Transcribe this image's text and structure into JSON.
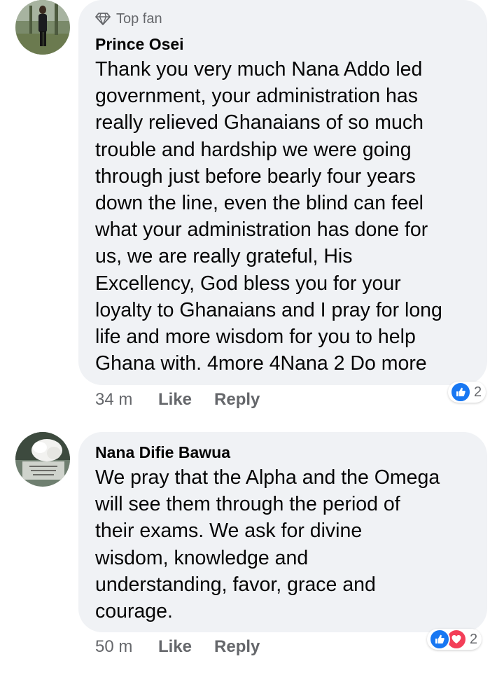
{
  "colors": {
    "bubble": "#f0f2f5",
    "secondary_text": "#65676b",
    "like_blue": "#1877f2",
    "love_red": "#f33e58"
  },
  "comments": [
    {
      "badge_icon": "diamond-icon",
      "badge": "Top fan",
      "author": "Prince Osei",
      "lines": [
        "Thank you very much Nana Addo led",
        "government, your administration has",
        "really relieved Ghanaians of so much",
        "trouble and hardship we were going",
        "through just before bearly four years",
        "down the line, even the blind can feel",
        "what your administration has done for",
        "us, we are really grateful, His",
        "Excellency, God bless you for your",
        "loyalty to Ghanaians and I pray for long",
        "life and more wisdom for you to help",
        "Ghana with. 4more 4Nana 2 Do more"
      ],
      "time": "34 m",
      "like_label": "Like",
      "reply_label": "Reply",
      "reactions": [
        "like-icon"
      ],
      "reaction_count": "2"
    },
    {
      "author": "Nana Difie Bawua",
      "lines": [
        "We pray that the Alpha and the Omega",
        "will see them through the period of",
        "their exams. We ask for divine",
        "wisdom, knowledge and",
        "understanding, favor, grace and",
        "courage."
      ],
      "time": "50 m",
      "like_label": "Like",
      "reply_label": "Reply",
      "reactions": [
        "like-icon",
        "love-icon"
      ],
      "reaction_count": "2"
    }
  ]
}
